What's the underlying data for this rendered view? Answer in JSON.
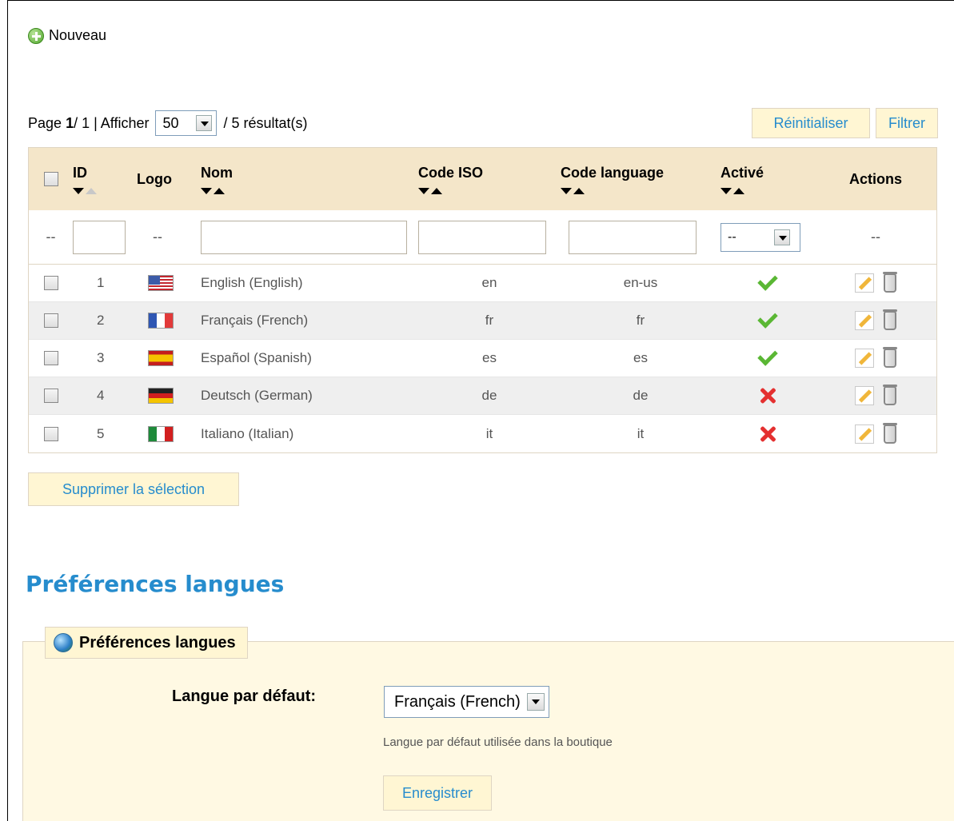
{
  "toolbar": {
    "new_label": "Nouveau"
  },
  "pager": {
    "page_prefix": "Page",
    "page_current": "1",
    "page_total_text": " / 1 | Afficher",
    "per_page": "50",
    "results_text": "/ 5 résultat(s)"
  },
  "buttons": {
    "reset": "Réinitialiser",
    "filter": "Filtrer",
    "delete_selection": "Supprimer la sélection",
    "save": "Enregistrer"
  },
  "table": {
    "headers": {
      "id": "ID",
      "logo": "Logo",
      "name": "Nom",
      "iso": "Code ISO",
      "lang_code": "Code language",
      "active": "Activé",
      "actions": "Actions"
    },
    "filter_placeholder": "--",
    "active_filter_value": "--",
    "rows": [
      {
        "id": "1",
        "flag": "flag-us",
        "name": "English (English)",
        "iso": "en",
        "lang_code": "en-us",
        "active": true
      },
      {
        "id": "2",
        "flag": "flag-fr",
        "name": "Français (French)",
        "iso": "fr",
        "lang_code": "fr",
        "active": true
      },
      {
        "id": "3",
        "flag": "flag-es",
        "name": "Español (Spanish)",
        "iso": "es",
        "lang_code": "es",
        "active": true
      },
      {
        "id": "4",
        "flag": "flag-de",
        "name": "Deutsch (German)",
        "iso": "de",
        "lang_code": "de",
        "active": false
      },
      {
        "id": "5",
        "flag": "flag-it",
        "name": "Italiano (Italian)",
        "iso": "it",
        "lang_code": "it",
        "active": false
      }
    ]
  },
  "preferences": {
    "section_title": "Préférences langues",
    "legend": "Préférences langues",
    "default_label": "Langue par défaut:",
    "default_value": "Français (French)",
    "hint": "Langue par défaut utilisée dans la boutique"
  },
  "colors": {
    "accent": "#268ccd",
    "header_bg": "#f4e6c9",
    "button_bg": "#fff6d3",
    "active_green": "#5ab734",
    "inactive_red": "#e43030"
  }
}
